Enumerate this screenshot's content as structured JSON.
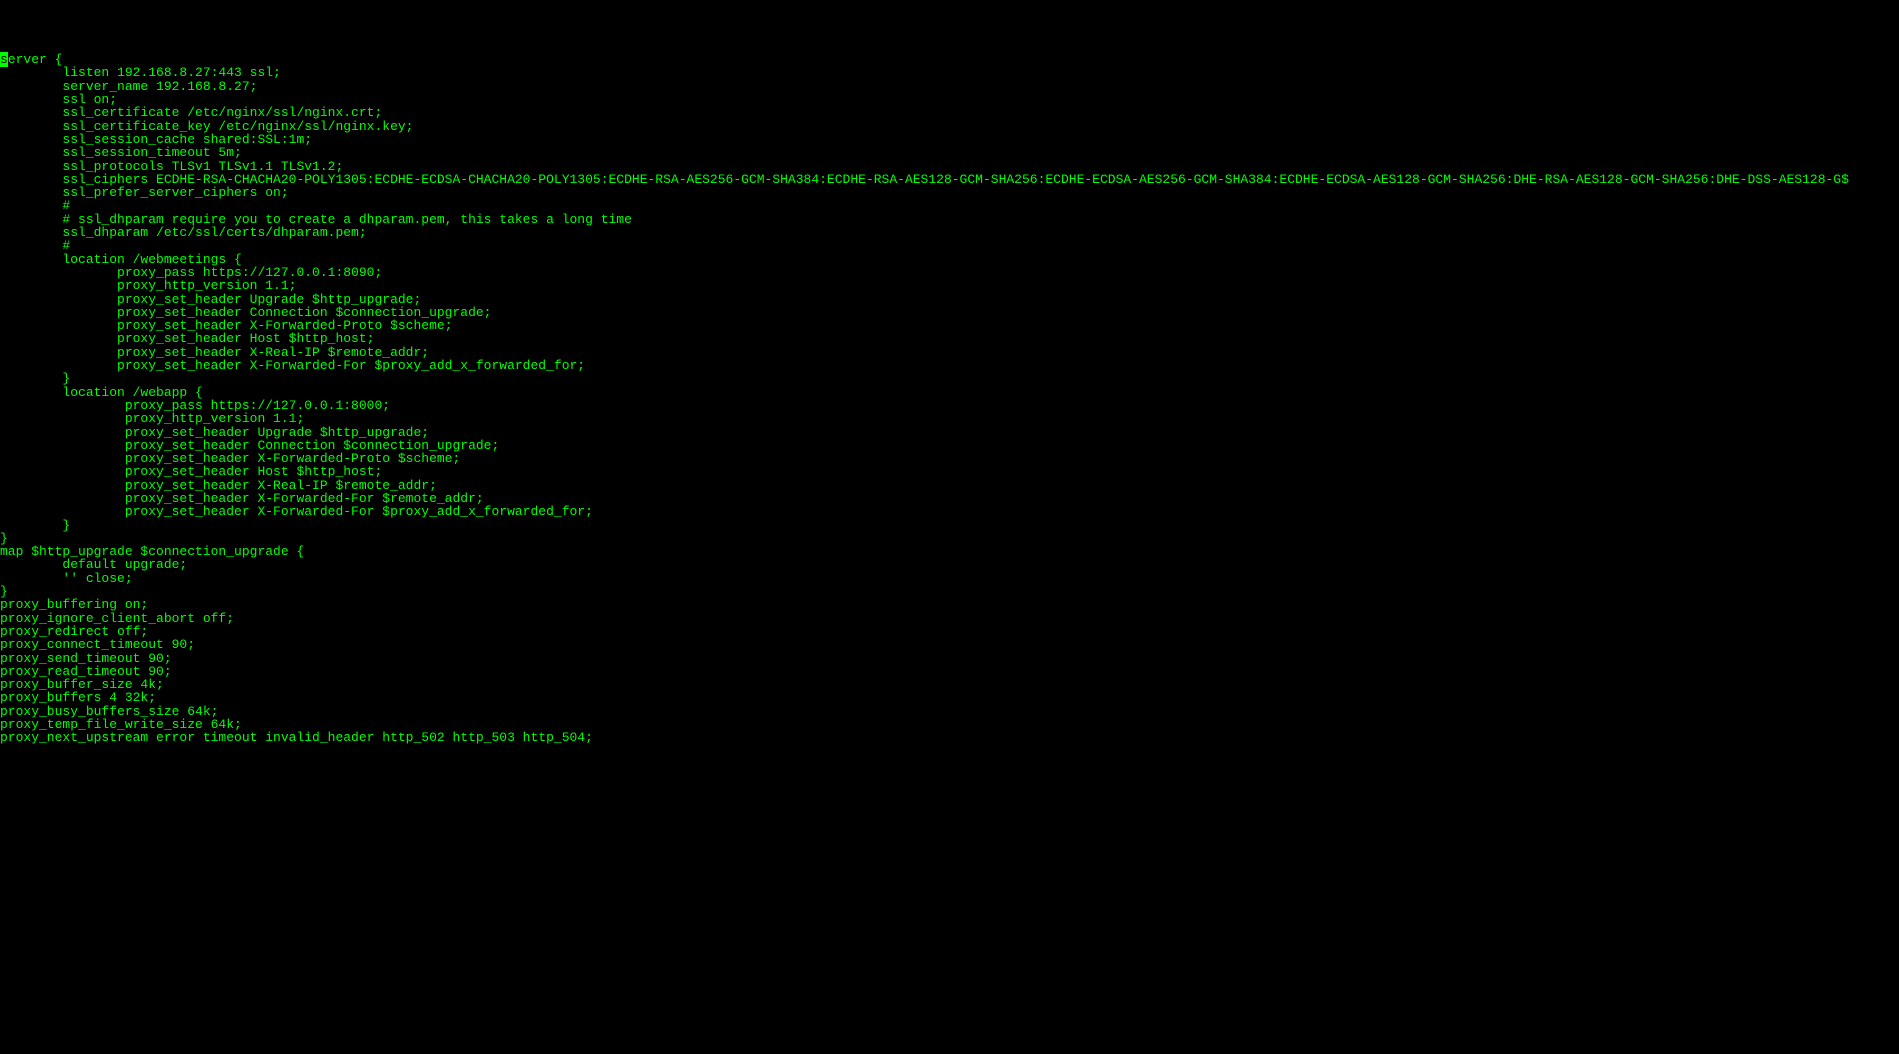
{
  "cursor_char": "s",
  "lines": [
    "erver {",
    "        listen 192.168.8.27:443 ssl;",
    "        server_name 192.168.8.27;",
    "",
    "        ssl on;",
    "        ssl_certificate /etc/nginx/ssl/nginx.crt;",
    "        ssl_certificate_key /etc/nginx/ssl/nginx.key;",
    "        ssl_session_cache shared:SSL:1m;",
    "        ssl_session_timeout 5m;",
    "        ssl_protocols TLSv1 TLSv1.1 TLSv1.2;",
    "        ssl_ciphers ECDHE-RSA-CHACHA20-POLY1305:ECDHE-ECDSA-CHACHA20-POLY1305:ECDHE-RSA-AES256-GCM-SHA384:ECDHE-RSA-AES128-GCM-SHA256:ECDHE-ECDSA-AES256-GCM-SHA384:ECDHE-ECDSA-AES128-GCM-SHA256:DHE-RSA-AES128-GCM-SHA256:DHE-DSS-AES128-G$",
    "        ssl_prefer_server_ciphers on;",
    "        #",
    "        # ssl_dhparam require you to create a dhparam.pem, this takes a long time",
    "        ssl_dhparam /etc/ssl/certs/dhparam.pem;",
    "        #",
    "        location /webmeetings {",
    "               proxy_pass https://127.0.0.1:8090;",
    "               proxy_http_version 1.1;",
    "               proxy_set_header Upgrade $http_upgrade;",
    "               proxy_set_header Connection $connection_upgrade;",
    "               proxy_set_header X-Forwarded-Proto $scheme;",
    "               proxy_set_header Host $http_host;",
    "               proxy_set_header X-Real-IP $remote_addr;",
    "               proxy_set_header X-Forwarded-For $proxy_add_x_forwarded_for;",
    "",
    "        }",
    "        location /webapp {",
    "                proxy_pass https://127.0.0.1:8000;",
    "                proxy_http_version 1.1;",
    "                proxy_set_header Upgrade $http_upgrade;",
    "                proxy_set_header Connection $connection_upgrade;",
    "                proxy_set_header X-Forwarded-Proto $scheme;",
    "                proxy_set_header Host $http_host;",
    "                proxy_set_header X-Real-IP $remote_addr;",
    "                proxy_set_header X-Forwarded-For $remote_addr;",
    "                proxy_set_header X-Forwarded-For $proxy_add_x_forwarded_for;",
    "",
    "        }",
    "",
    "}",
    "map $http_upgrade $connection_upgrade {",
    "        default upgrade;",
    "        '' close;",
    "}",
    "",
    "proxy_buffering on;",
    "proxy_ignore_client_abort off;",
    "proxy_redirect off;",
    "proxy_connect_timeout 90;",
    "proxy_send_timeout 90;",
    "proxy_read_timeout 90;",
    "proxy_buffer_size 4k;",
    "proxy_buffers 4 32k;",
    "proxy_busy_buffers_size 64k;",
    "proxy_temp_file_write_size 64k;",
    "proxy_next_upstream error timeout invalid_header http_502 http_503 http_504;"
  ]
}
